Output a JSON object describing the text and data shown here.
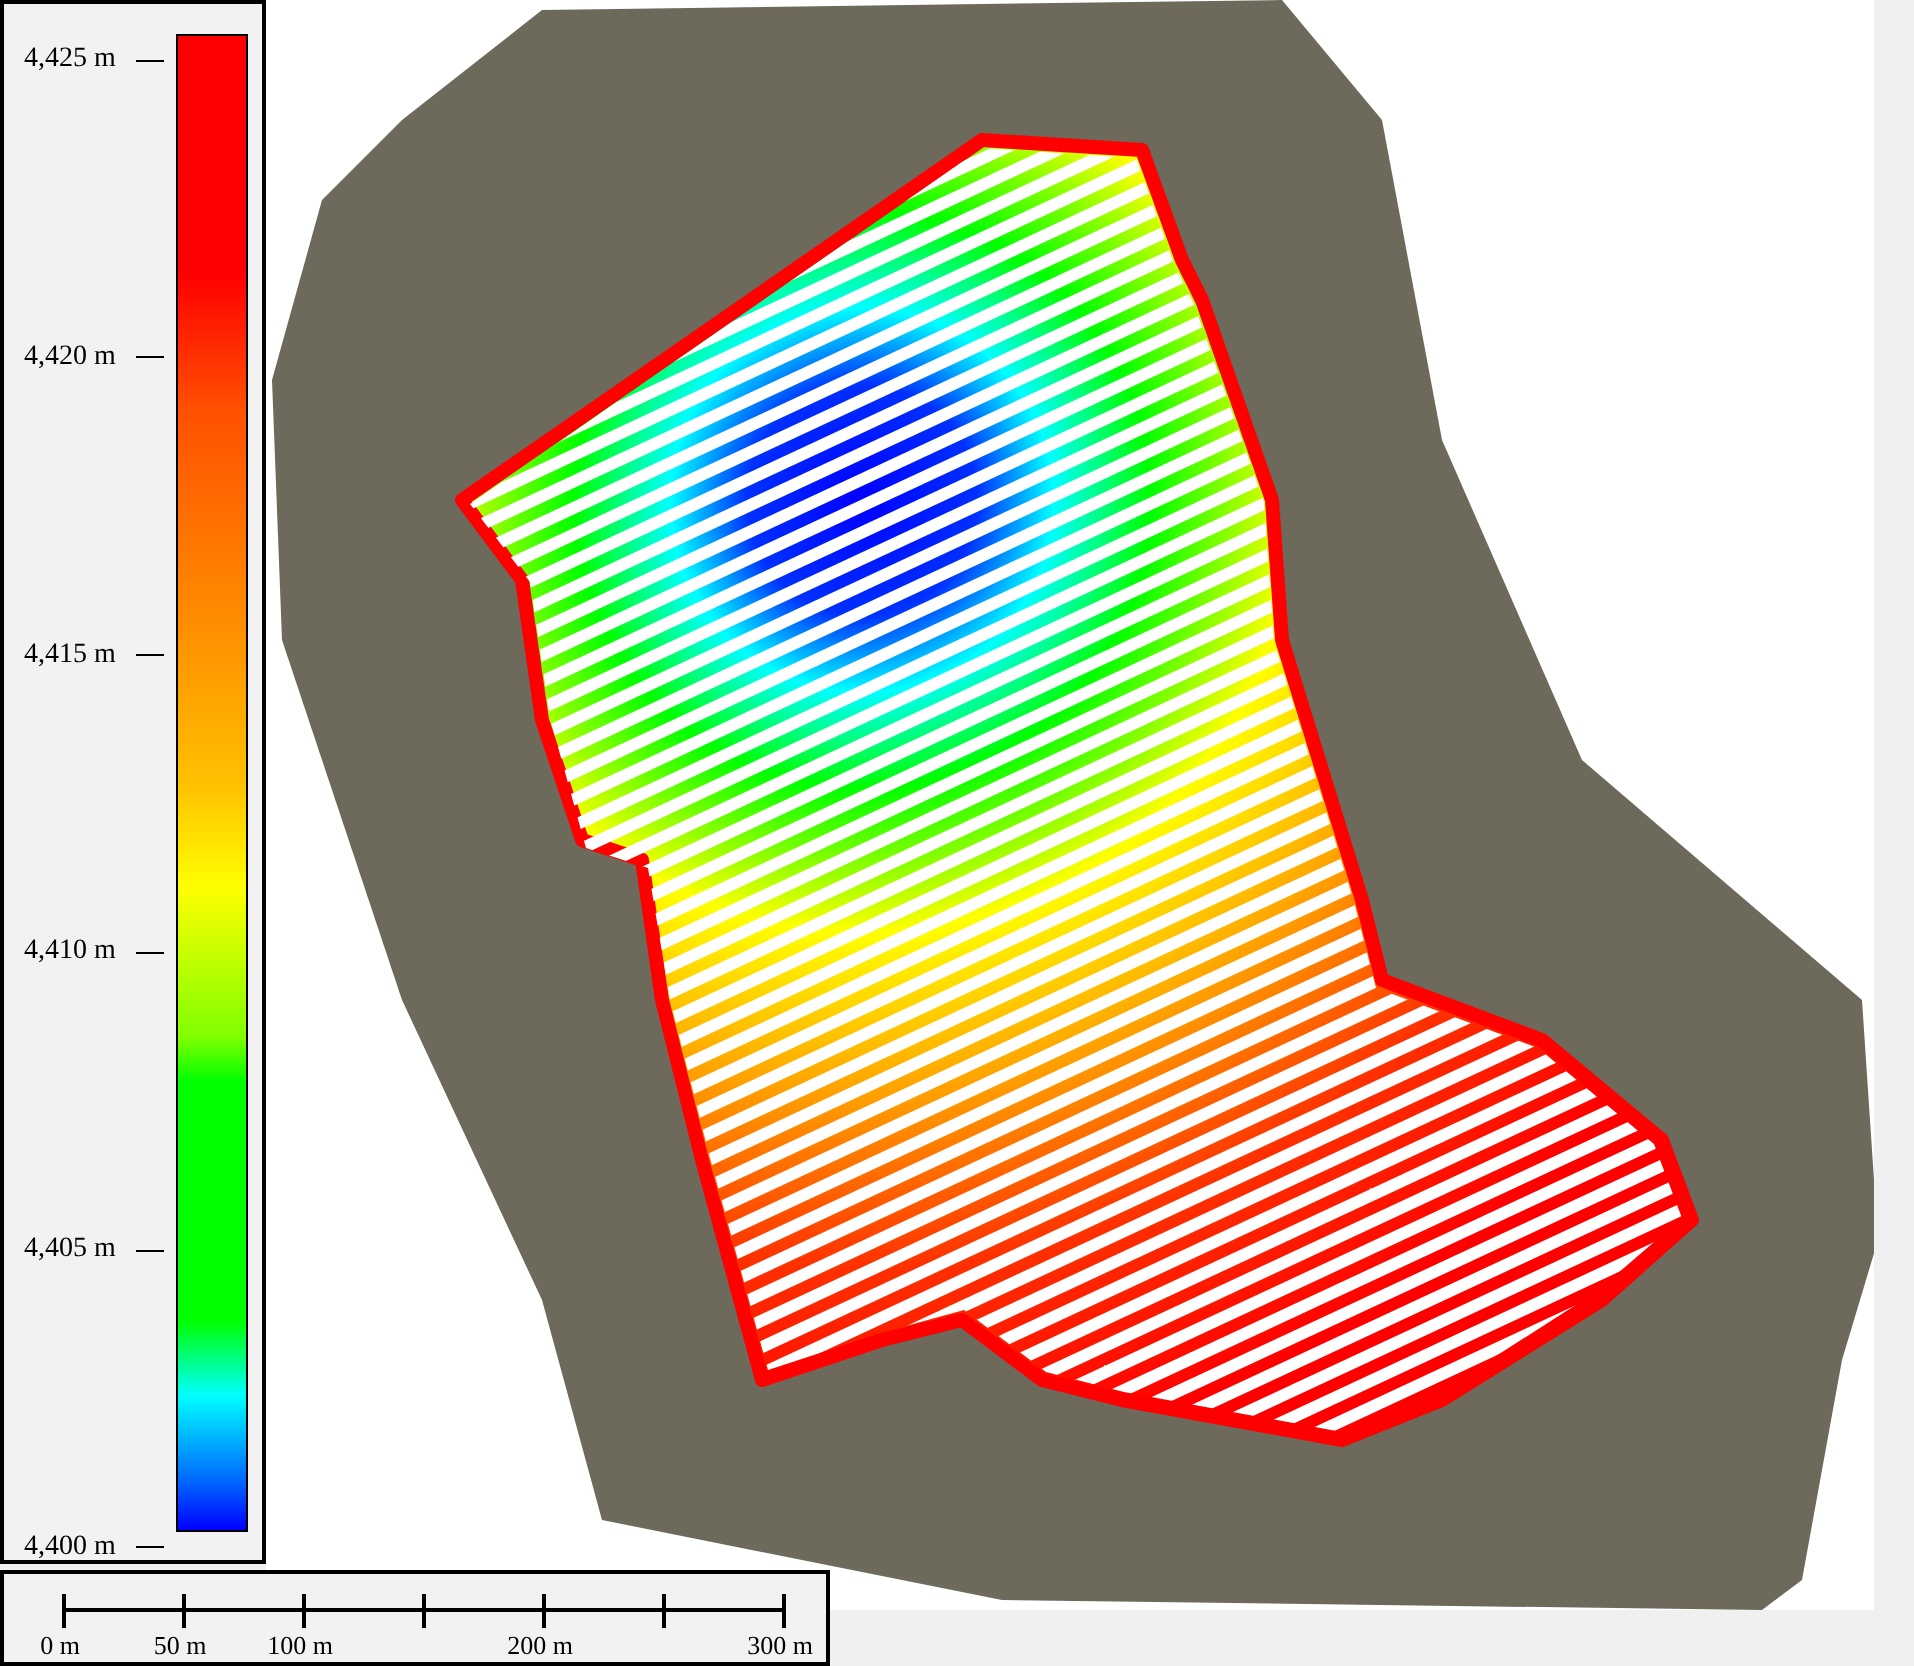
{
  "legend": {
    "ticks": [
      "4,425 m",
      "4,420 m",
      "4,415 m",
      "4,410 m",
      "4,405 m",
      "4,400 m"
    ]
  },
  "scale_bar": {
    "labels": [
      "0 m",
      "50 m",
      "100 m",
      "200 m",
      "300 m"
    ]
  }
}
